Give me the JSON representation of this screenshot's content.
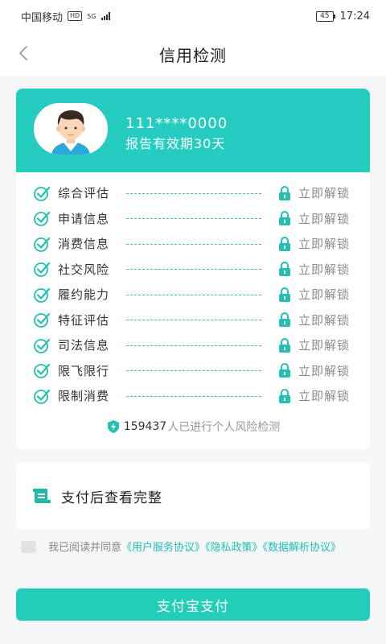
{
  "status_bar": {
    "carrier": "中国移动",
    "hd": "HD",
    "signal": "5G",
    "battery": "45",
    "time": "17:24"
  },
  "nav": {
    "title": "信用检测",
    "back_icon": "chevron-left-icon"
  },
  "user": {
    "phone": "111****0000",
    "valid_text": "报告有效期30天"
  },
  "items": [
    {
      "label": "综合评估",
      "action": "立即解锁"
    },
    {
      "label": "申请信息",
      "action": "立即解锁"
    },
    {
      "label": "消费信息",
      "action": "立即解锁"
    },
    {
      "label": "社交风险",
      "action": "立即解锁"
    },
    {
      "label": "履约能力",
      "action": "立即解锁"
    },
    {
      "label": "特征评估",
      "action": "立即解锁"
    },
    {
      "label": "司法信息",
      "action": "立即解锁"
    },
    {
      "label": "限飞限行",
      "action": "立即解锁"
    },
    {
      "label": "限制消费",
      "action": "立即解锁"
    }
  ],
  "footnote": {
    "count": "159437",
    "text": "人已进行个人风险检测"
  },
  "pay_card": {
    "text": "支付后查看完整"
  },
  "agreement": {
    "prefix": "我已阅读并同意",
    "link1": "《用户服务协议》",
    "link2": "《隐私政策》",
    "link3": "《数据解析协议》"
  },
  "pay_button": {
    "label": "支付宝支付"
  },
  "colors": {
    "accent": "#24cdc0",
    "button": "#22cdb9",
    "link": "#1fbfb4"
  }
}
